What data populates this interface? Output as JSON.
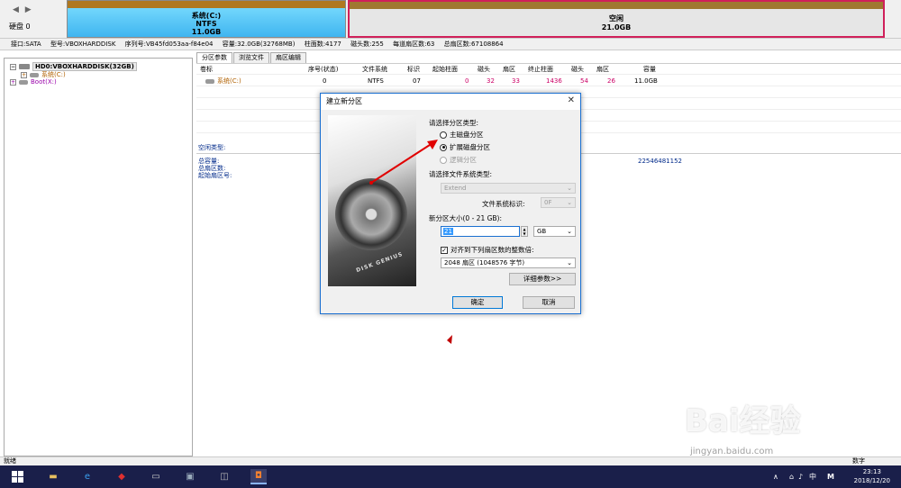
{
  "disk_panel": {
    "nav": "◀ ▶",
    "disk_label": "硬盘 0",
    "system_partition": {
      "line1": "系统(C:)",
      "line2": "NTFS",
      "line3": "11.0GB"
    },
    "free_space": {
      "line1": "空闲",
      "line2": "21.0GB"
    }
  },
  "info_line": [
    "接口:SATA",
    "型号:VBOXHARDDISK",
    "序列号:VB45fd053aa-f84e04",
    "容量:32.0GB(32768MB)",
    "柱面数:4177",
    "磁头数:255",
    "每道扇区数:63",
    "总扇区数:67108864"
  ],
  "tree": {
    "hdd": "HD0:VBOXHARDDISK(32GB)",
    "system": "系统(C:)",
    "boot": "Boot(X:)"
  },
  "tabs": [
    "分区参数",
    "浏览文件",
    "扇区编辑"
  ],
  "grid": {
    "headers": [
      "卷标",
      "序号(状态)",
      "文件系统",
      "标识",
      "起始柱面",
      "磁头",
      "扇区",
      "终止柱面",
      "磁头",
      "扇区",
      "容量"
    ],
    "row": [
      "系统(C:)",
      "0",
      "NTFS",
      "07",
      "0",
      "32",
      "33",
      "1436",
      "54",
      "26",
      "11.0GB"
    ]
  },
  "stats": {
    "free_type": "空闲类型:",
    "total_capacity": "总容量:",
    "total_sectors": "总扇区数:",
    "start_sector": "起始扇区号:",
    "bytes_value": "22546481152"
  },
  "dialog": {
    "title": "建立新分区",
    "close": "✕",
    "brand": "DISK GENIUS",
    "type_label": "请选择分区类型:",
    "radio_primary": "主磁盘分区",
    "radio_extended": "扩展磁盘分区",
    "radio_logical": "逻辑分区",
    "fs_label": "请选择文件系统类型:",
    "fs_value": "Extend",
    "fs_id_label": "文件系统标识:",
    "fs_id_value": "0F",
    "size_label": "新分区大小(0 - 21 GB):",
    "size_value": "21",
    "unit_value": "GB",
    "align_label": "对齐到下列扇区数的整数倍:",
    "align_value": "2048 扇区 (1048576 字节)",
    "details_button": "详细参数>>",
    "ok_button": "确定",
    "cancel_button": "取消"
  },
  "status_bar": {
    "ready": "就绪",
    "num": "数字"
  },
  "taskbar": {
    "tray_input": "中",
    "tray_m": "M",
    "time": "23:13",
    "date": "2018/12/20"
  },
  "watermark": {
    "text": "Bai经验",
    "url": "jingyan.baidu.com"
  }
}
